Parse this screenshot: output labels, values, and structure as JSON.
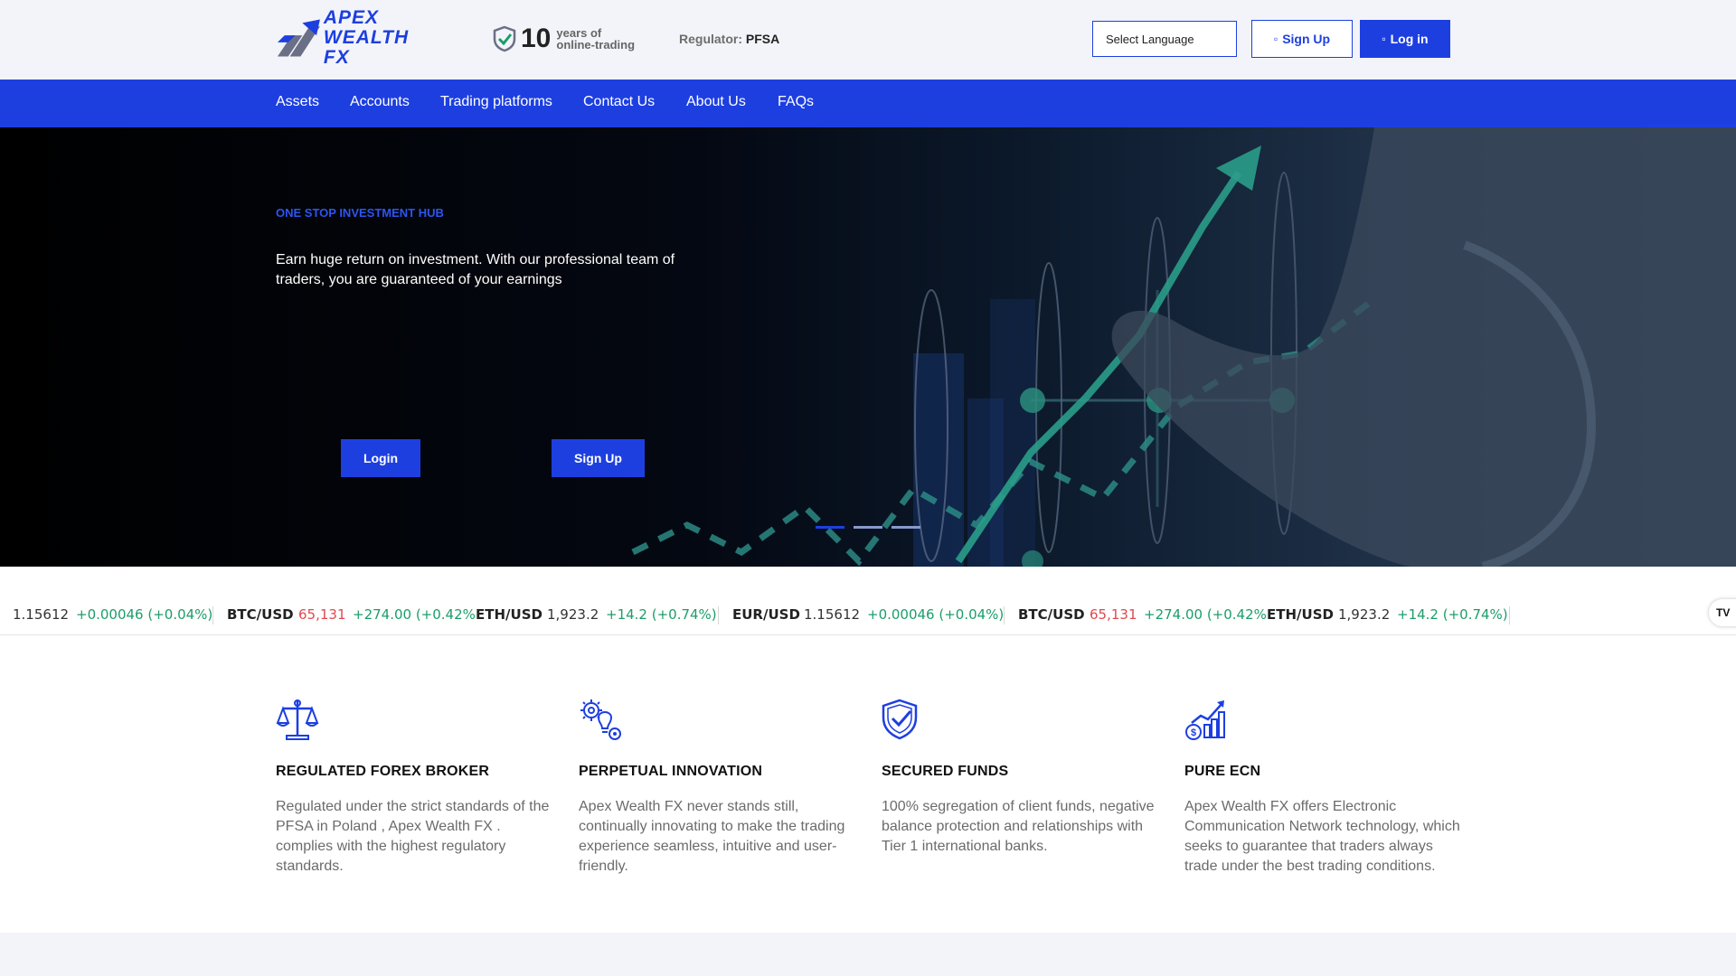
{
  "header": {
    "logo": {
      "line1": "Apex",
      "line2": "Wealth FX"
    },
    "years": {
      "number": "10",
      "label_line1": "years of",
      "label_line2": "online-trading"
    },
    "regulator": {
      "label": "Regulator:",
      "value": "PFSA"
    },
    "language_select": {
      "value": "Select Language"
    },
    "signup_label": "Sign Up",
    "login_label": "Log in",
    "signup_icon": "user-plus-icon",
    "login_icon": "sign-in-icon"
  },
  "nav": {
    "items": [
      {
        "label": "Assets"
      },
      {
        "label": "Accounts"
      },
      {
        "label": "Trading platforms"
      },
      {
        "label": "Contact Us"
      },
      {
        "label": "About Us"
      },
      {
        "label": "FAQs"
      }
    ]
  },
  "hero": {
    "tagline": "ONE STOP INVESTMENT HUB",
    "text": "Earn huge return on investment. With our professional team of traders, you are guaranteed of your earnings",
    "login_label": "Login",
    "signup_label": "Sign Up",
    "slides": 3,
    "active_slide": 0
  },
  "ticker": {
    "items": [
      {
        "symbol": "",
        "price": "1.15612",
        "change": "+0.00046 (+0.04%)",
        "price_down": false
      },
      {
        "symbol": "BTC/USD",
        "price": "65,131",
        "change": "+274.00 (+0.42%",
        "price_down": true
      },
      {
        "symbol": "ETH/USD",
        "price": "1,923.2",
        "change": "+14.2 (+0.74%)",
        "price_down": false
      },
      {
        "symbol": "EUR/USD",
        "price": "1.15612",
        "change": "+0.00046 (+0.04%)",
        "price_down": false
      },
      {
        "symbol": "BTC/USD",
        "price": "65,131",
        "change": "+274.00 (+0.42%",
        "price_down": true
      },
      {
        "symbol": "ETH/USD",
        "price": "1,923.2",
        "change": "+14.2 (+0.74%)",
        "price_down": false
      }
    ],
    "badge": "TV"
  },
  "features": [
    {
      "icon": "scales-icon",
      "title": "REGULATED FOREX BROKER",
      "text": "Regulated under the strict standards of the PFSA in Poland , Apex Wealth FX . complies with the highest regulatory standards."
    },
    {
      "icon": "gear-bulb-icon",
      "title": "PERPETUAL INNOVATION",
      "text": "Apex Wealth FX never stands still, continually innovating to make the trading experience seamless, intuitive and user-friendly."
    },
    {
      "icon": "shield-check-icon",
      "title": "SECURED FUNDS",
      "text": "100% segregation of client funds, negative balance protection and relationships with Tier 1 international banks."
    },
    {
      "icon": "growth-chart-icon",
      "title": "PURE ECN",
      "text": "Apex Wealth FX offers Electronic Communication Network technology, which seeks to guarantee that traders always trade under the best trading conditions."
    }
  ],
  "colors": {
    "accent": "#1d3fe0",
    "ticker_up": "#1b9d6b",
    "ticker_down": "#e0484e",
    "header_bg": "#f3f4f9"
  }
}
